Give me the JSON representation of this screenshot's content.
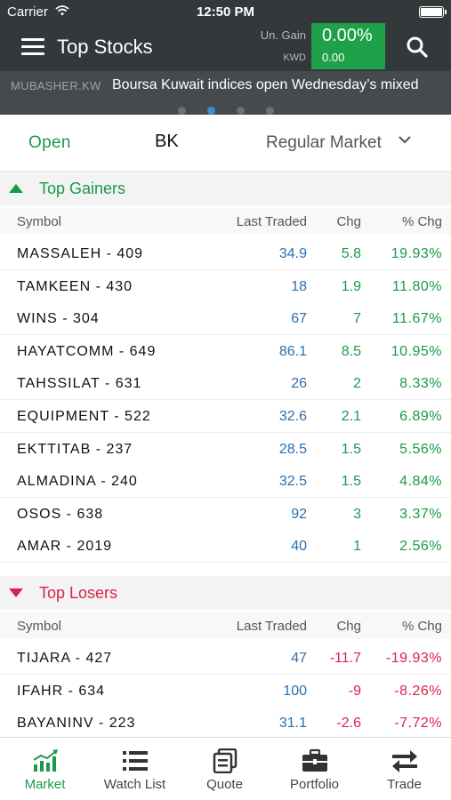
{
  "status_bar": {
    "carrier": "Carrier",
    "time": "12:50 PM"
  },
  "header": {
    "title": "Top Stocks",
    "unrealized_gain_label": "Un. Gain",
    "currency_label": "KWD",
    "gain_percent": "0.00%",
    "gain_value": "0.00",
    "gain_box_color": "#1fa149"
  },
  "ticker": {
    "source": "MUBASHER.KW",
    "headline": "Boursa Kuwait indices open Wednesday’s mixed",
    "page_count": 4,
    "active_page": 2
  },
  "market_selector": {
    "status": "Open",
    "exchange": "BK",
    "market": "Regular Market"
  },
  "columns": {
    "symbol": "Symbol",
    "last_traded": "Last Traded",
    "change": "Chg",
    "percent_change": "% Chg"
  },
  "top_gainers": {
    "label": "Top Gainers",
    "color": "#1a9a47",
    "rows": [
      {
        "symbol": "MASSALEH - 409",
        "last": "34.9",
        "chg": "5.8",
        "pct": "19.93%"
      },
      {
        "symbol": "TAMKEEN - 430",
        "last": "18",
        "chg": "1.9",
        "pct": "11.80%"
      },
      {
        "symbol": "WINS - 304",
        "last": "67",
        "chg": "7",
        "pct": "11.67%"
      },
      {
        "symbol": "HAYATCOMM - 649",
        "last": "86.1",
        "chg": "8.5",
        "pct": "10.95%"
      },
      {
        "symbol": "TAHSSILAT - 631",
        "last": "26",
        "chg": "2",
        "pct": "8.33%"
      },
      {
        "symbol": "EQUIPMENT - 522",
        "last": "32.6",
        "chg": "2.1",
        "pct": "6.89%"
      },
      {
        "symbol": "EKTTITAB - 237",
        "last": "28.5",
        "chg": "1.5",
        "pct": "5.56%"
      },
      {
        "symbol": "ALMADINA - 240",
        "last": "32.5",
        "chg": "1.5",
        "pct": "4.84%"
      },
      {
        "symbol": "OSOS - 638",
        "last": "92",
        "chg": "3",
        "pct": "3.37%"
      },
      {
        "symbol": "AMAR - 2019",
        "last": "40",
        "chg": "1",
        "pct": "2.56%"
      }
    ]
  },
  "top_losers": {
    "label": "Top Losers",
    "color": "#d8234a",
    "rows": [
      {
        "symbol": "TIJARA - 427",
        "last": "47",
        "chg": "-11.7",
        "pct": "-19.93%"
      },
      {
        "symbol": "IFAHR - 634",
        "last": "100",
        "chg": "-9",
        "pct": "-8.26%"
      },
      {
        "symbol": "BAYANINV - 223",
        "last": "31.1",
        "chg": "-2.6",
        "pct": "-7.72%"
      }
    ]
  },
  "tabbar": {
    "active": "market",
    "tabs": [
      {
        "id": "market",
        "label": "Market",
        "icon": "bar-chart-icon"
      },
      {
        "id": "watchlist",
        "label": "Watch List",
        "icon": "list-icon"
      },
      {
        "id": "quote",
        "label": "Quote",
        "icon": "quote-icon"
      },
      {
        "id": "portfolio",
        "label": "Portfolio",
        "icon": "briefcase-icon"
      },
      {
        "id": "trade",
        "label": "Trade",
        "icon": "swap-arrows-icon"
      }
    ]
  }
}
